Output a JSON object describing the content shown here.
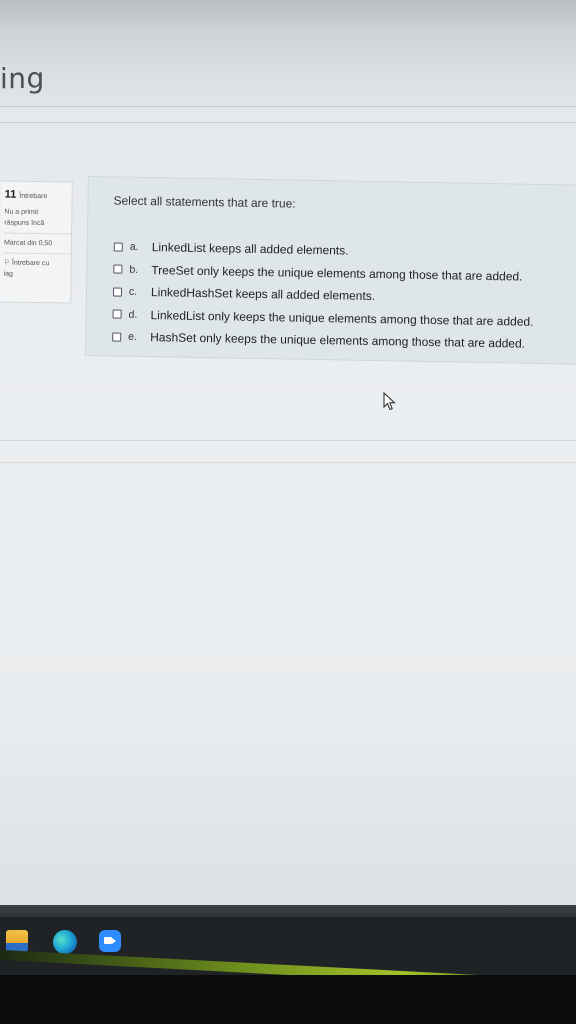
{
  "header": {
    "title_fragment": "ing"
  },
  "question_info": {
    "number": "11",
    "number_label": "Întrebare",
    "status_line1": "Nu a primit",
    "status_line2": "răspuns încă",
    "mark": "Marcat din 0,50",
    "flag_line1": "Întrebare cu",
    "flag_line2": "iag"
  },
  "question": {
    "text": "Select all statements that are true:",
    "options": [
      {
        "letter": "a.",
        "text": "LinkedList keeps all added elements."
      },
      {
        "letter": "b.",
        "text": "TreeSet only keeps the unique elements among those that are added."
      },
      {
        "letter": "c.",
        "text": "LinkedHashSet keeps all added elements."
      },
      {
        "letter": "d.",
        "text": "LinkedList only keeps the unique elements among those that are added."
      },
      {
        "letter": "e.",
        "text": "HashSet only keeps the unique elements among those that are added."
      }
    ]
  },
  "taskbar": {
    "icons": [
      "file-explorer-icon",
      "edge-browser-icon",
      "zoom-app-icon"
    ]
  }
}
